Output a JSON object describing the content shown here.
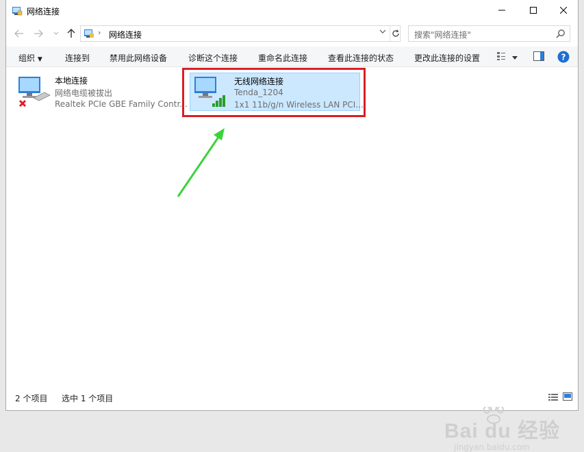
{
  "window": {
    "title": "网络连接"
  },
  "address_bar": {
    "path": "网络连接",
    "search_placeholder": "搜索\"网络连接\""
  },
  "toolbar": {
    "organize": "组织",
    "connect_to": "连接到",
    "disable": "禁用此网络设备",
    "diagnose": "诊断这个连接",
    "rename": "重命名此连接",
    "view_status": "查看此连接的状态",
    "change_settings": "更改此连接的设置"
  },
  "connections": [
    {
      "name": "本地连接",
      "status": "网络电缆被拔出",
      "adapter": "Realtek PCIe GBE Family Contr..."
    },
    {
      "name": "无线网络连接",
      "status": "Tenda_1204",
      "adapter": "1x1 11b/g/n Wireless LAN PCI..."
    }
  ],
  "statusbar": {
    "count": "2 个项目",
    "selected": "选中 1 个项目"
  },
  "watermark": {
    "brand": "Bai du 经验",
    "url": "jingyan.baidu.com"
  },
  "colors": {
    "selection": "#cce8ff",
    "highlight": "#d91e25",
    "arrow": "#3bd33b",
    "help": "#1f6fd0"
  }
}
